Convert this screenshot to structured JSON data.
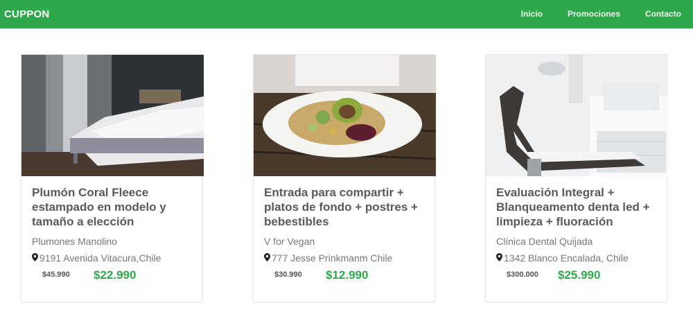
{
  "brand": "CUPPON",
  "nav": [
    "Inicio",
    "Promociones",
    "Contacto"
  ],
  "cards": [
    {
      "title": "Plumón Coral Fleece estampado en modelo y tamaño a elección",
      "store": "Plumones Manolino",
      "address": "9191 Avenida Vitacura,Chile",
      "old_price": "$45.990",
      "new_price": "$22.990",
      "image_icon": "bedroom-photo"
    },
    {
      "title": "Entrada para compartir + platos de fondo + postres + bebestibles",
      "store": "V for Vegan",
      "address": "777 Jesse Prinkmanm Chile",
      "old_price": "$30.990",
      "new_price": "$12.990",
      "image_icon": "salad-photo"
    },
    {
      "title": "Evaluación Integral + Blanqueamento denta led + limpieza + fluoración",
      "store": "Clínica Dental Quijada",
      "address": "1342 Blanco Encalada, Chile",
      "old_price": "$300.000",
      "new_price": "$25.990",
      "image_icon": "dental-chair-photo"
    }
  ],
  "colors": {
    "primary": "#2ea84a",
    "text": "#5a5a5a",
    "muted": "#777777"
  }
}
